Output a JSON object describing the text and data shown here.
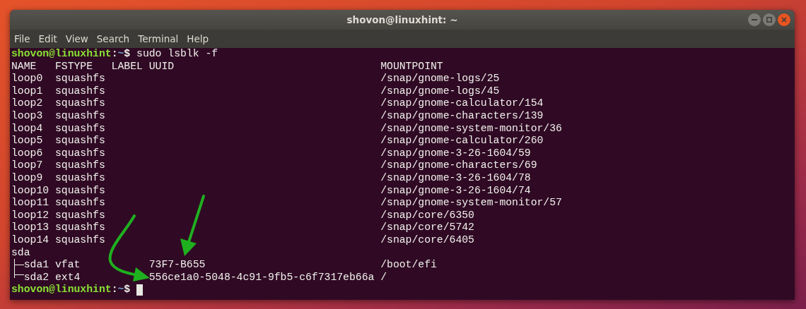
{
  "window": {
    "title": "shovon@linuxhint: ~"
  },
  "menu": [
    "File",
    "Edit",
    "View",
    "Search",
    "Terminal",
    "Help"
  ],
  "terminal": {
    "prompt": {
      "user_host": "shovon@linuxhint",
      "separator": ":",
      "path": "~",
      "symbol": "$",
      "command": "sudo lsblk -f"
    },
    "columns": [
      "NAME",
      "FSTYPE",
      "LABEL",
      "UUID",
      "MOUNTPOINT"
    ],
    "rows": [
      {
        "name": "loop0",
        "fstype": "squashfs",
        "mountpoint": "/snap/gnome-logs/25"
      },
      {
        "name": "loop1",
        "fstype": "squashfs",
        "mountpoint": "/snap/gnome-logs/45"
      },
      {
        "name": "loop2",
        "fstype": "squashfs",
        "mountpoint": "/snap/gnome-calculator/154"
      },
      {
        "name": "loop3",
        "fstype": "squashfs",
        "mountpoint": "/snap/gnome-characters/139"
      },
      {
        "name": "loop4",
        "fstype": "squashfs",
        "mountpoint": "/snap/gnome-system-monitor/36"
      },
      {
        "name": "loop5",
        "fstype": "squashfs",
        "mountpoint": "/snap/gnome-calculator/260"
      },
      {
        "name": "loop6",
        "fstype": "squashfs",
        "mountpoint": "/snap/gnome-3-26-1604/59"
      },
      {
        "name": "loop7",
        "fstype": "squashfs",
        "mountpoint": "/snap/gnome-characters/69"
      },
      {
        "name": "loop9",
        "fstype": "squashfs",
        "mountpoint": "/snap/gnome-3-26-1604/78"
      },
      {
        "name": "loop10",
        "fstype": "squashfs",
        "mountpoint": "/snap/gnome-3-26-1604/74"
      },
      {
        "name": "loop11",
        "fstype": "squashfs",
        "mountpoint": "/snap/gnome-system-monitor/57"
      },
      {
        "name": "loop12",
        "fstype": "squashfs",
        "mountpoint": "/snap/core/6350"
      },
      {
        "name": "loop13",
        "fstype": "squashfs",
        "mountpoint": "/snap/core/5742"
      },
      {
        "name": "loop14",
        "fstype": "squashfs",
        "mountpoint": "/snap/core/6405"
      },
      {
        "name": "sda",
        "children": [
          {
            "name": "sda1",
            "fstype": "vfat",
            "uuid": "73F7-B655",
            "mountpoint": "/boot/efi"
          },
          {
            "name": "sda2",
            "fstype": "ext4",
            "uuid": "556ce1a0-5048-4c91-9fb5-c6f7317eb66a",
            "mountpoint": "/"
          }
        ]
      }
    ],
    "final_prompt": {
      "user_host": "shovon@linuxhint",
      "separator": ":",
      "path": "~",
      "symbol": "$",
      "cursor": true
    }
  }
}
